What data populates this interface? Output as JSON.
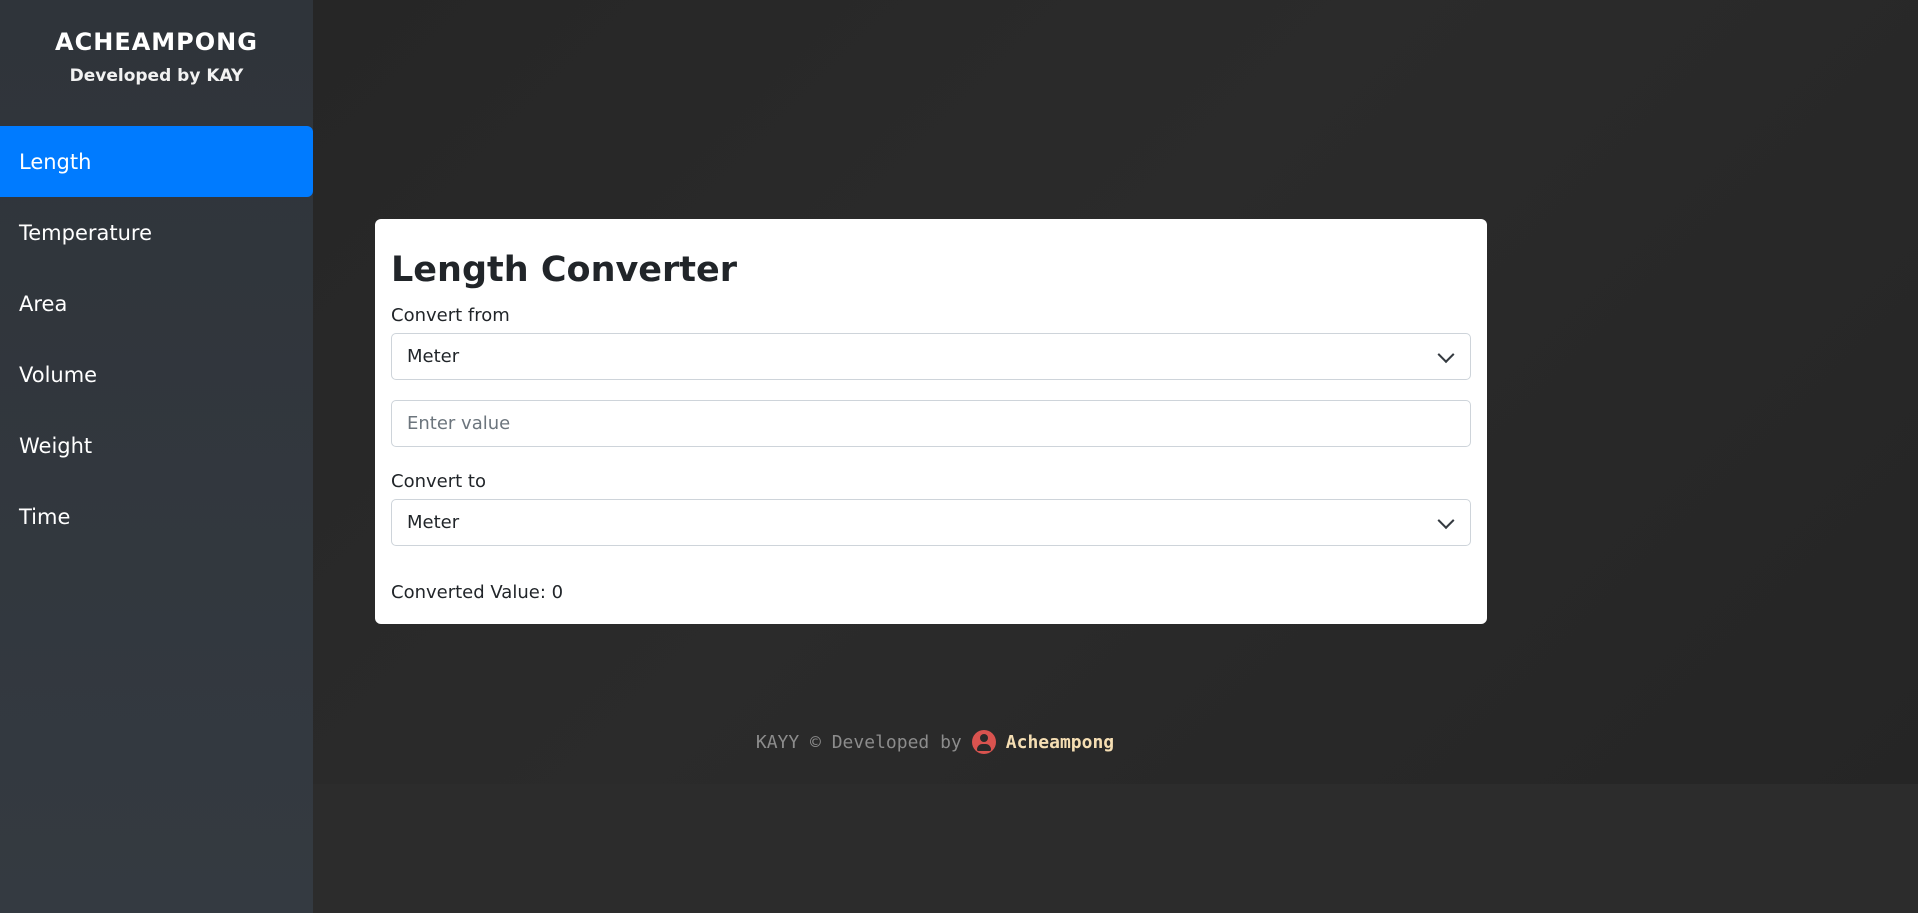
{
  "sidebar": {
    "brand": "ACHEAMPONG",
    "subtitle": "Developed by KAY",
    "items": [
      {
        "label": "Length"
      },
      {
        "label": "Temperature"
      },
      {
        "label": "Area"
      },
      {
        "label": "Volume"
      },
      {
        "label": "Weight"
      },
      {
        "label": "Time"
      }
    ],
    "active_item": "Length"
  },
  "converter": {
    "title": "Length Converter",
    "from_label": "Convert from",
    "from_value": "Meter",
    "value_placeholder": "Enter value",
    "to_label": "Convert to",
    "to_value": "Meter",
    "result_text": "Converted Value: 0"
  },
  "footer": {
    "prefix": "KAYY © Developed by",
    "author": "Acheampong",
    "icon": "user-circle-icon"
  },
  "colors": {
    "accent": "#007bff",
    "sidebar_bg": "#343a40",
    "main_bg": "#262626",
    "author": "#f5deb3",
    "icon": "#d9534f"
  }
}
